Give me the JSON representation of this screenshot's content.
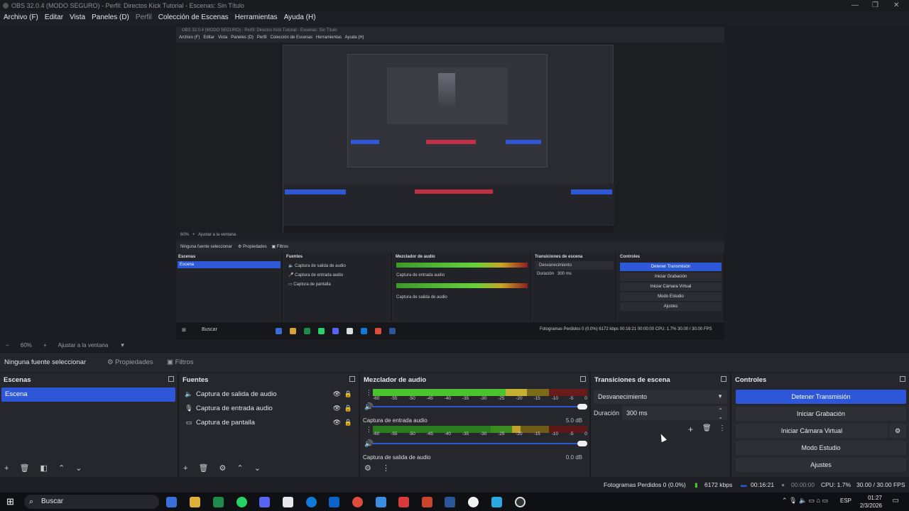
{
  "window": {
    "title": "OBS 32.0.4 (MODO SEGURO) - Perfil: Directos Kick Tutorial - Escenas: Sin Título"
  },
  "menu": [
    "Archivo (F)",
    "Editar",
    "Vista",
    "Paneles (D)",
    "Perfil",
    "Colección de Escenas",
    "Herramientas",
    "Ayuda (H)"
  ],
  "zoom": {
    "value": "60%",
    "fit_label": "Ajustar a la ventana"
  },
  "props": {
    "no_source": "Ninguna fuente seleccionar",
    "properties": "Propiedades",
    "filters": "Filtros"
  },
  "scenes": {
    "title": "Escenas",
    "items": [
      "Escena"
    ]
  },
  "sources": {
    "title": "Fuentes",
    "items": [
      "Captura de salida de audio",
      "Captura de entrada audio",
      "Captura de pantalla"
    ]
  },
  "mixer": {
    "title": "Mezclador de audio",
    "ticks": [
      "-60",
      "-55",
      "-50",
      "-45",
      "-40",
      "-35",
      "-30",
      "-25",
      "-20",
      "-15",
      "-10",
      "-5",
      "0"
    ],
    "channels": [
      {
        "name": "",
        "db": "",
        "level": 0.78
      },
      {
        "name": "Captura de entrada audio",
        "db": "5.0 dB",
        "level": 0.68
      },
      {
        "name": "Captura de salida de audio",
        "db": "0.0 dB"
      }
    ]
  },
  "transitions": {
    "title": "Transiciones de escena",
    "type": "Desvanecimiento",
    "duration_label": "Duración",
    "duration": "300 ms"
  },
  "controls": {
    "title": "Controles",
    "stop_stream": "Detener Transmisión",
    "start_record": "Iniciar Grabación",
    "virtual_cam": "Iniciar Cámara Virtual",
    "studio_mode": "Modo Estudio",
    "settings": "Ajustes"
  },
  "status": {
    "dropped": "Fotogramas Perdidos 0 (0.0%)",
    "bitrate": "6172 kbps",
    "stream_time": "00:16:21",
    "rec_time": "00:00:00",
    "cpu": "CPU: 1.7%",
    "fps": "30.00 / 30.00 FPS"
  },
  "taskbar": {
    "search": "Buscar",
    "lang": "ESP",
    "time": "01:27",
    "date": "2/3/2026"
  },
  "nested": {
    "status": "Fotogramas Perdidos 0 (0.0%)   6172 kbps   00:16:21   00:00:00   CPU: 1.7%   30.00 / 30.00 FPS"
  },
  "colors": {
    "accent": "#2d57d8",
    "panel": "#26272c",
    "background": "#1e1f24"
  }
}
